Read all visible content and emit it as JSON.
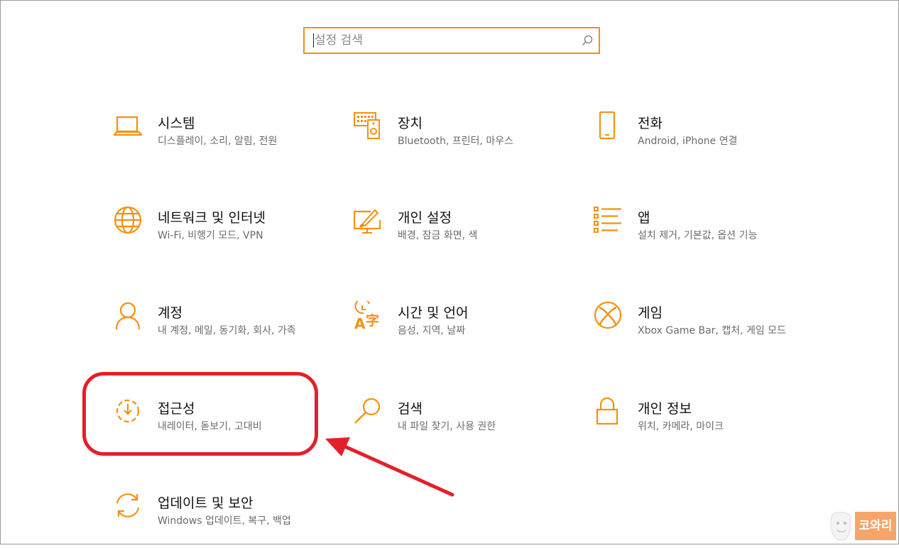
{
  "search": {
    "placeholder": "설정 검색"
  },
  "tiles": [
    {
      "title": "시스템",
      "desc": "디스플레이, 소리, 알림, 전원",
      "icon": "laptop-icon"
    },
    {
      "title": "장치",
      "desc": "Bluetooth, 프린터, 마우스",
      "icon": "devices-icon"
    },
    {
      "title": "전화",
      "desc": "Android, iPhone 연결",
      "icon": "phone-icon"
    },
    {
      "title": "네트워크 및 인터넷",
      "desc": "Wi-Fi, 비행기 모드, VPN",
      "icon": "globe-icon"
    },
    {
      "title": "개인 설정",
      "desc": "배경, 잠금 화면, 색",
      "icon": "personalization-icon"
    },
    {
      "title": "앱",
      "desc": "설치 제거, 기본값, 옵션 기능",
      "icon": "apps-list-icon"
    },
    {
      "title": "계정",
      "desc": "내 계정, 메일, 동기화, 회사, 가족",
      "icon": "person-icon"
    },
    {
      "title": "시간 및 언어",
      "desc": "음성, 지역, 날짜",
      "icon": "time-language-icon"
    },
    {
      "title": "게임",
      "desc": "Xbox Game Bar, 캡처, 게임 모드",
      "icon": "xbox-icon"
    },
    {
      "title": "접근성",
      "desc": "내레이터, 돋보기, 고대비",
      "icon": "accessibility-icon"
    },
    {
      "title": "검색",
      "desc": "내 파일 찾기, 사용 권한",
      "icon": "search-magnifier-icon"
    },
    {
      "title": "개인 정보",
      "desc": "위치, 카메라, 마이크",
      "icon": "lock-icon"
    },
    {
      "title": "업데이트 및 보안",
      "desc": "Windows 업데이트, 복구, 백업",
      "icon": "sync-icon"
    }
  ],
  "colors": {
    "accent": "#f29111",
    "highlight": "#e3202a",
    "desc_text": "#6b6b6b"
  },
  "watermark": {
    "text": "코와리"
  }
}
